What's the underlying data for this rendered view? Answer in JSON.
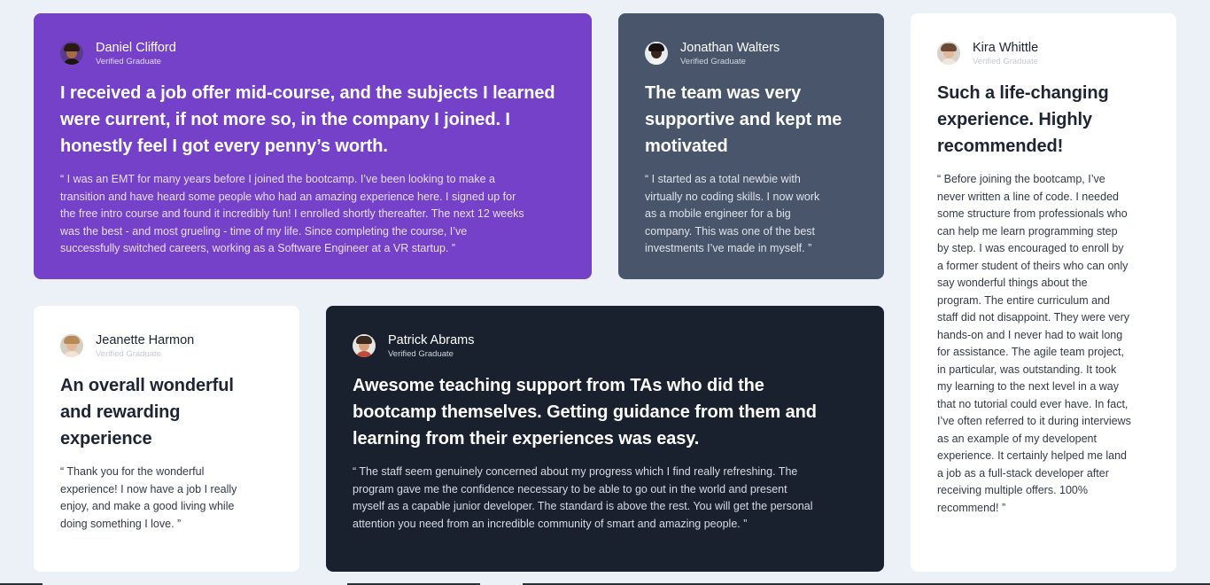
{
  "testimonials": [
    {
      "name": "Daniel Clifford",
      "role": "Verified Graduate",
      "headline": "I received a job offer mid-course, and the subjects I learned were current, if not more so, in the company I joined. I honestly feel I got every penny’s worth.",
      "quote": "“ I was an EMT for many years before I joined the bootcamp. I’ve been looking to make a transition and have heard some people who had an amazing experience here. I signed up for the free intro course and found it incredibly fun! I enrolled shortly thereafter. The next 12 weeks was the best - and most grueling - time of my life. Since completing the course, I’ve successfully switched careers, working as a Software Engineer at a VR startup. ”",
      "accent": "#7541c8"
    },
    {
      "name": "Jonathan Walters",
      "role": "Verified Graduate",
      "headline": "The team was very supportive and kept me motivated",
      "quote": "“ I started as a total newbie with virtually no coding skills. I now work as a mobile engineer for a big company. This was one of the best investments I’ve made in myself. ”",
      "accent": "#48556a"
    },
    {
      "name": "Kira Whittle",
      "role": "Verified Graduate",
      "headline": "Such a life-changing experience. Highly recommended!",
      "quote": "“ Before joining the bootcamp, I’ve never written a line of code. I needed some structure from professionals who can help me learn programming step by step. I was encouraged to enroll by a former student of theirs who can only say wonderful things about the program. The entire curriculum and staff did not disappoint. They were very hands-on and I never had to wait long for assistance. The agile team project, in particular, was outstanding. It took my learning to the next level in a way that no tutorial could ever have. In fact, I’ve often referred to it during interviews as an example of my developent experience. It certainly helped me land a job as a full-stack developer after receiving multiple offers. 100% recommend! ”",
      "accent": "#ffffff"
    },
    {
      "name": "Jeanette Harmon",
      "role": "Verified Graduate",
      "headline": "An overall wonderful and rewarding experience",
      "quote": "“ Thank you for the wonderful experience! I now have a job I really enjoy, and make a good living while doing something I love. ”",
      "accent": "#ffffff"
    },
    {
      "name": "Patrick Abrams",
      "role": "Verified Graduate",
      "headline": "Awesome teaching support from TAs who did the bootcamp themselves. Getting guidance from them and learning from their experiences was easy.",
      "quote": "“ The staff seem genuinely concerned about my progress which I find really refreshing. The program gave me the confidence necessary to be able to go out in the world and present myself as a capable junior developer. The standard is above the rest. You will get the personal attention you need from an incredible community of smart and amazing people. ”",
      "accent": "#19212e"
    }
  ]
}
